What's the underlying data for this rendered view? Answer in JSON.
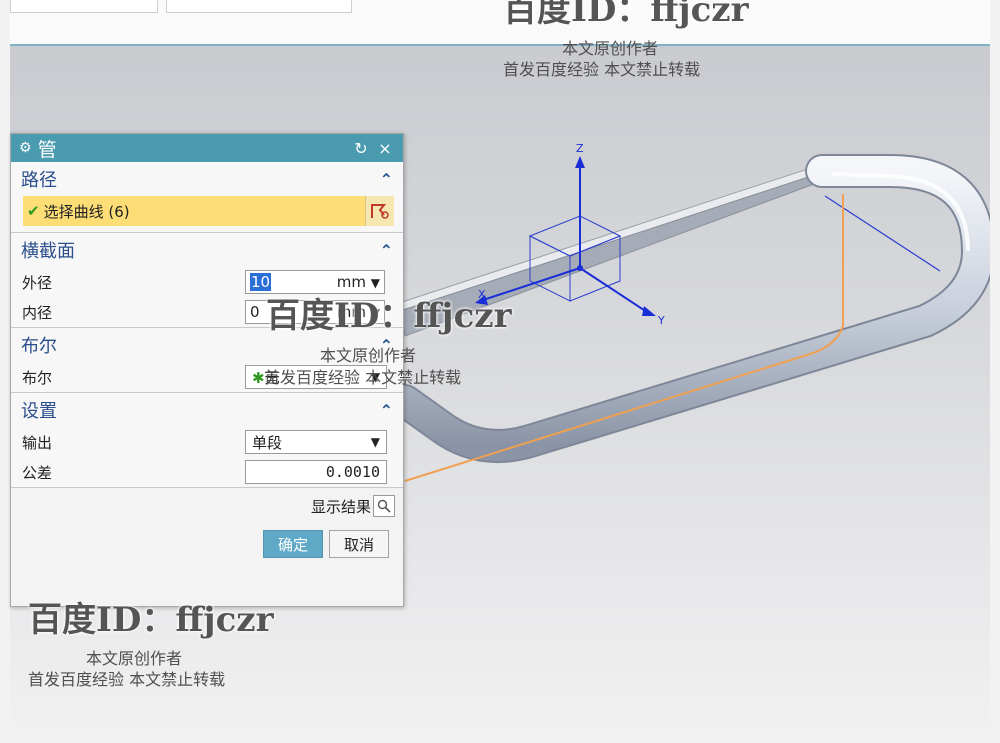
{
  "dialog": {
    "title": "管",
    "reset_glyph": "↻",
    "close_glyph": "×",
    "path_section": {
      "title": "路径",
      "select_label": "选择曲线 (6)"
    },
    "cross_section": {
      "title": "横截面",
      "outer_label": "外径",
      "outer_value": "10",
      "outer_unit": "mm",
      "inner_label": "内径",
      "inner_value": "0",
      "inner_unit": "mm"
    },
    "boolean_section": {
      "title": "布尔",
      "bool_label": "布尔",
      "bool_value": "无"
    },
    "settings_section": {
      "title": "设置",
      "output_label": "输出",
      "output_value": "单段",
      "tolerance_label": "公差",
      "tolerance_value": "0.0010"
    },
    "show_result_label": "显示结果",
    "ok_label": "确定",
    "cancel_label": "取消"
  },
  "axes": {
    "z": "Z",
    "x": "X",
    "y": "Y"
  },
  "watermark": {
    "id_text": "百度ID：ffjczr",
    "line1": "本文原创作者",
    "line2": "首发百度经验  本文禁止转载"
  },
  "colors": {
    "title_bar": "#4a9bb0",
    "highlight": "#fcdd76",
    "path_curve": "#f0a050",
    "axis": "#1a2ed6"
  }
}
